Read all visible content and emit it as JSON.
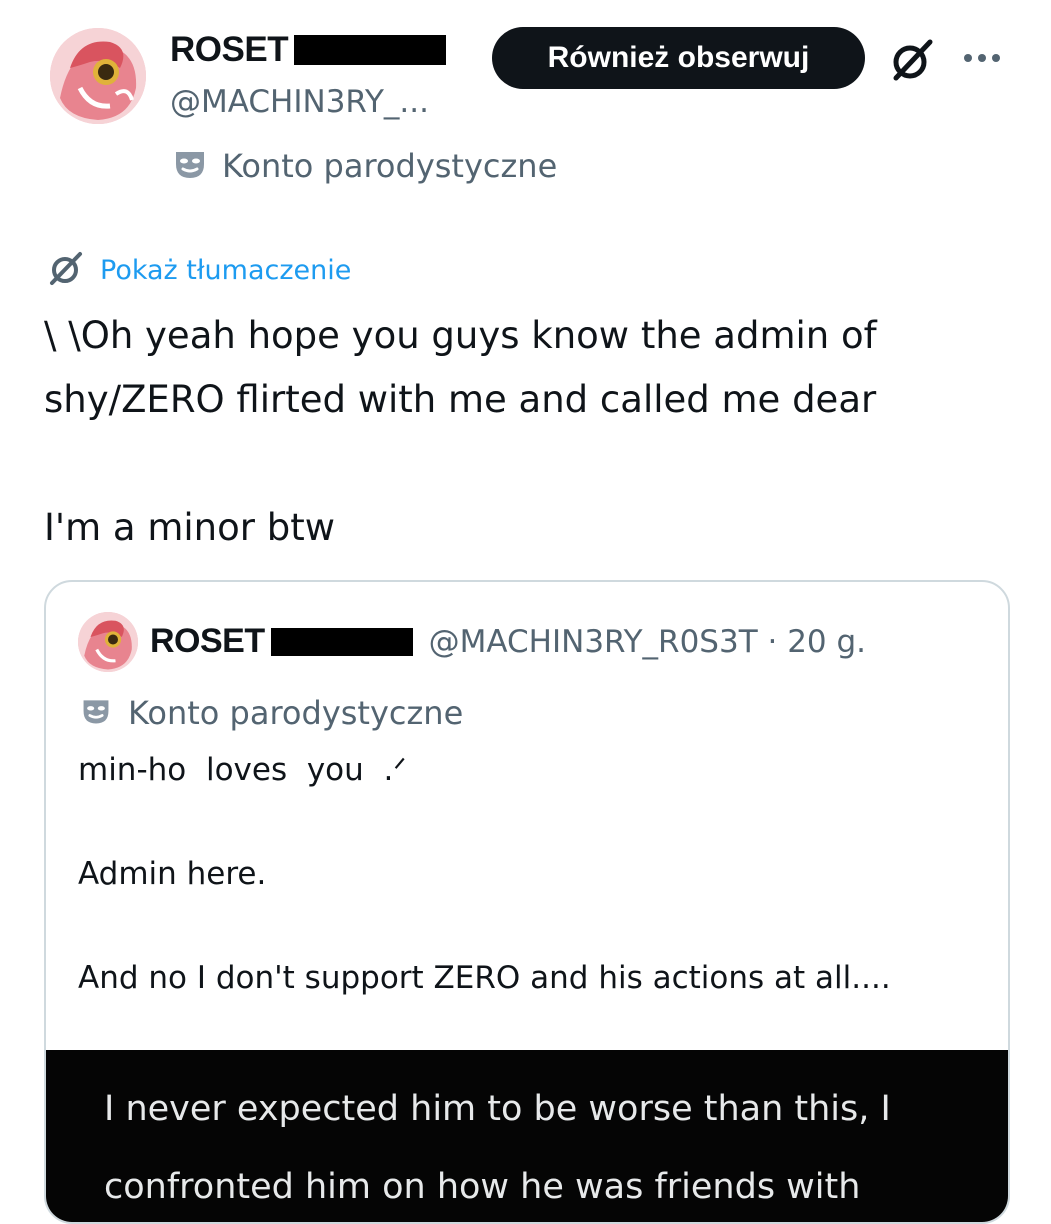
{
  "post": {
    "author_name": "ROSET",
    "handle": "@MACHIN3RY_...",
    "follow_label": "Również obserwuj",
    "parody_label": "Konto parodystyczne",
    "translate_label": "Pokaż tłumaczenie",
    "text": "\\ \\Oh yeah hope you guys know the admin of\nshy/ZERO flirted with me and called me dear\n\nI'm a minor btw"
  },
  "quote": {
    "author_name": "ROSET",
    "handle_time": "@MACHIN3RY_R0S3T · 20 g.",
    "parody_label": "Konto parodystyczne",
    "text": "min-ho  loves  you  .ᐟ\n\nAdmin here.\n\nAnd no I don't support ZERO and his actions at all....",
    "image_text": "I never expected him to be worse than this, I\nconfronted him on how he was friends with"
  },
  "icons": {
    "grok": "grok-icon",
    "more": "more-dots-icon",
    "parody": "theater-mask-icon",
    "translate": "grok-translate-icon"
  }
}
